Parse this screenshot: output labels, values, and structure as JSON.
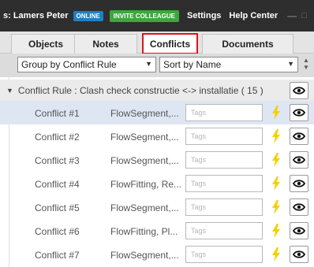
{
  "titlebar": {
    "user": "s: Lamers Peter",
    "status_badge": "ONLINE",
    "invite_label": "INVITE COLLEAGUE",
    "settings_label": "Settings",
    "help_label": "Help Center",
    "minimize_glyph": "—",
    "maximize_glyph": "□"
  },
  "tabs": [
    {
      "label": "Objects",
      "active": false
    },
    {
      "label": "Notes",
      "active": false
    },
    {
      "label": "Conflicts",
      "active": true
    },
    {
      "label": "Documents",
      "active": false
    }
  ],
  "toolbar": {
    "group_by": "Group by Conflict Rule",
    "sort_by": "Sort by Name"
  },
  "group": {
    "label": "Conflict Rule : Clash check constructie <-> installatie ( 15 )"
  },
  "tags_placeholder": "Tags",
  "conflicts": [
    {
      "name": "Conflict #1",
      "type": "FlowSegment,...",
      "selected": true
    },
    {
      "name": "Conflict #2",
      "type": "FlowSegment,...",
      "selected": false
    },
    {
      "name": "Conflict #3",
      "type": "FlowSegment,...",
      "selected": false
    },
    {
      "name": "Conflict #4",
      "type": "FlowFitting, Re...",
      "selected": false
    },
    {
      "name": "Conflict #5",
      "type": "FlowSegment,...",
      "selected": false
    },
    {
      "name": "Conflict #6",
      "type": "FlowFitting, Pl...",
      "selected": false
    },
    {
      "name": "Conflict #7",
      "type": "FlowSegment,...",
      "selected": false
    }
  ],
  "colors": {
    "accent_red": "#d8151e",
    "online_blue": "#1f7fc4",
    "invite_green": "#3fa63f",
    "bolt_yellow": "#f5d000",
    "selected_row": "#dfe6f3"
  }
}
